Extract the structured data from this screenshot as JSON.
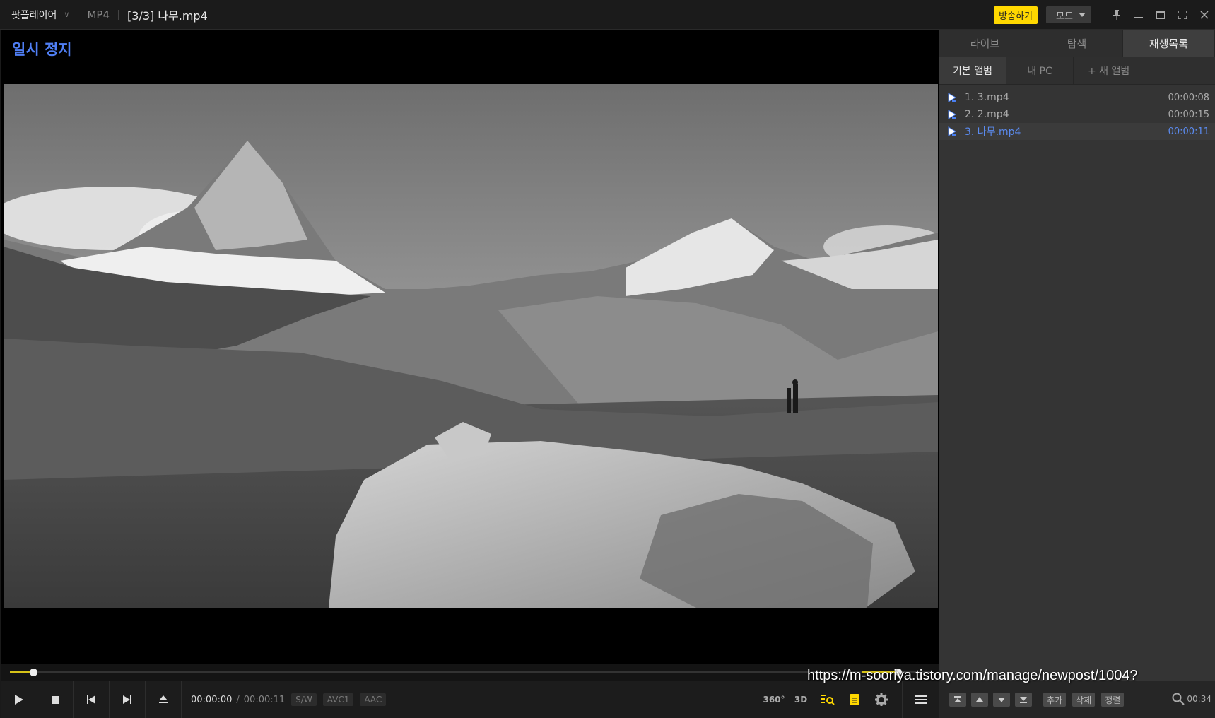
{
  "titlebar": {
    "app_name": "팟플레이어",
    "format": "MP4",
    "title": "[3/3] 나무.mp4",
    "broadcast_label": "방송하기",
    "mode_label": "모드"
  },
  "video": {
    "osd_text": "일시 정지"
  },
  "controls": {
    "time_current": "00:00:00",
    "time_separator": "/",
    "time_total": "00:00:11",
    "badges": [
      "S/W",
      "AVC1",
      "AAC"
    ],
    "right_icons": {
      "vr": "360°",
      "stereo": "3D"
    },
    "seek_progress": 0.025,
    "volume_level": 0.85
  },
  "sidebar": {
    "tabs": [
      {
        "label": "라이브",
        "active": false
      },
      {
        "label": "탐색",
        "active": false
      },
      {
        "label": "재생목록",
        "active": true
      }
    ],
    "subtabs": [
      {
        "label": "기본 앨범",
        "active": true
      },
      {
        "label": "내 PC",
        "active": false
      },
      {
        "label": "+ 새 앨범",
        "active": false
      }
    ],
    "playlist": [
      {
        "name": "1. 3.mp4",
        "duration": "00:00:08",
        "active": false
      },
      {
        "name": "2. 2.mp4",
        "duration": "00:00:15",
        "active": false
      },
      {
        "name": "3. 나무.mp4",
        "duration": "00:00:11",
        "active": true
      }
    ],
    "bottom_buttons": [
      "추가",
      "삭제",
      "정렬"
    ],
    "total_time": "00:34"
  },
  "overlay_url": "https://m-sooriya.tistory.com/manage/newpost/1004?",
  "colors": {
    "accent_yellow": "#ffd800",
    "osd_blue": "#4f7ef3",
    "active_blue": "#5b8bf0"
  }
}
